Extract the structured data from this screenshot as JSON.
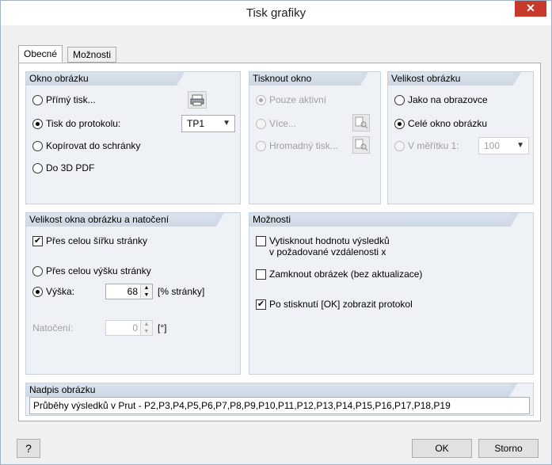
{
  "window": {
    "title": "Tisk grafiky",
    "close": "✕"
  },
  "tabs": [
    {
      "label": "Obecné"
    },
    {
      "label": "Možnosti"
    }
  ],
  "okno_obrazku": {
    "header": "Okno obrázku",
    "options": [
      "Přímý tisk...",
      "Tisk do protokolu:",
      "Kopírovat do schránky",
      "Do 3D PDF"
    ],
    "selected": "Tisk do protokolu:",
    "protocol_value": "TP1"
  },
  "tisknout_okno": {
    "header": "Tisknout okno",
    "options": [
      "Pouze aktivní",
      "Více...",
      "Hromadný tisk..."
    ]
  },
  "velikost_obrazku": {
    "header": "Velikost obrázku",
    "options": [
      "Jako na obrazovce",
      "Celé okno obrázku",
      "V měřítku 1:"
    ],
    "scale_value": "100"
  },
  "velikost_okna": {
    "header": "Velikost okna obrázku a natočení",
    "full_width": "Přes celou šířku stránky",
    "full_height": "Přes celou výšku stránky",
    "height_label": "Výška:",
    "height_value": "68",
    "height_unit": "[% stránky]",
    "rotation_label": "Natočení:",
    "rotation_value": "0",
    "rotation_unit": "[°]"
  },
  "moznosti": {
    "header": "Možnosti",
    "opt1_line1": "Vytisknout hodnotu výsledků",
    "opt1_line2": "v požadované vzdálenosti x",
    "opt2": "Zamknout obrázek (bez aktualizace)",
    "opt3": "Po stisknutí [OK] zobrazit protokol"
  },
  "nadpis": {
    "header": "Nadpis obrázku",
    "value": "Průběhy výsledků v  Prut -  P2,P3,P4,P5,P6,P7,P8,P9,P10,P11,P12,P13,P14,P15,P16,P17,P18,P19"
  },
  "buttons": {
    "ok": "OK",
    "cancel": "Storno",
    "help": "?"
  }
}
